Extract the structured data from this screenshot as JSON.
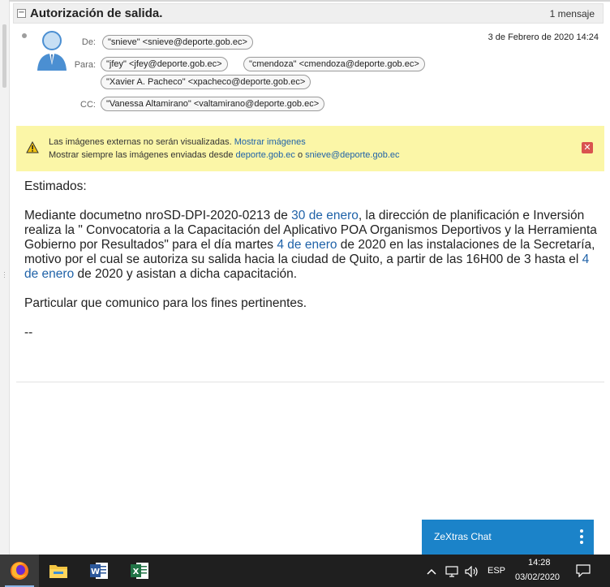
{
  "subject": "Autorización de salida.",
  "message_count": "1 mensaje",
  "header": {
    "from_label": "De:",
    "from": "\"snieve\" <snieve@deporte.gob.ec>",
    "to_label": "Para:",
    "to": [
      "\"jfey\" <jfey@deporte.gob.ec>",
      "\"cmendoza\" <cmendoza@deporte.gob.ec>",
      "\"Xavier A. Pacheco\" <xpacheco@deporte.gob.ec>"
    ],
    "cc_label": "CC:",
    "cc": [
      "\"Vanessa Altamirano\" <valtamirano@deporte.gob.ec>"
    ],
    "date": "3 de Febrero de 2020 14:24"
  },
  "warning": {
    "text1": "Las imágenes externas no serán visualizadas.",
    "show_link": "Mostrar imágenes",
    "text2": "Mostrar siempre las imágenes enviadas desde",
    "domain_link": "deporte.gob.ec",
    "or": "o",
    "email_link": "snieve@deporte.gob.ec",
    "close": "✕"
  },
  "body": {
    "greeting": "Estimados:",
    "p1_a": "Mediante documetno nroSD-DPI-2020-0213 de ",
    "p1_date1": "30 de enero",
    "p1_b": ", la dirección de planificación e Inversión realiza la \" Convocatoria a la Capacitación del Aplicativo POA Organismos Deportivos y la Herramienta Gobierno por Resultados\" para el día martes ",
    "p1_date2": "4 de enero",
    "p1_c": " de 2020 en las instalaciones de la Secretaría, motivo por el cual se autoriza su salida hacia la ciudad de Quito, a partir de las 16H00 de 3 hasta el ",
    "p1_date3": "4 de enero",
    "p1_d": " de 2020  y asistan a dicha capacitación.",
    "p2": "Particular que comunico para los fines pertinentes.",
    "sig": "--"
  },
  "chat": {
    "title": "ZeXtras Chat"
  },
  "taskbar": {
    "apps": [
      "firefox-icon",
      "file-explorer-icon",
      "word-icon",
      "excel-icon"
    ],
    "lang": "ESP",
    "time": "14:28",
    "date": "03/02/2020"
  },
  "colors": {
    "link": "#1f62a8",
    "warning_bg": "#fbf6a7",
    "chat_bg": "#1b83c9",
    "taskbar_bg": "#1f1f1f"
  }
}
